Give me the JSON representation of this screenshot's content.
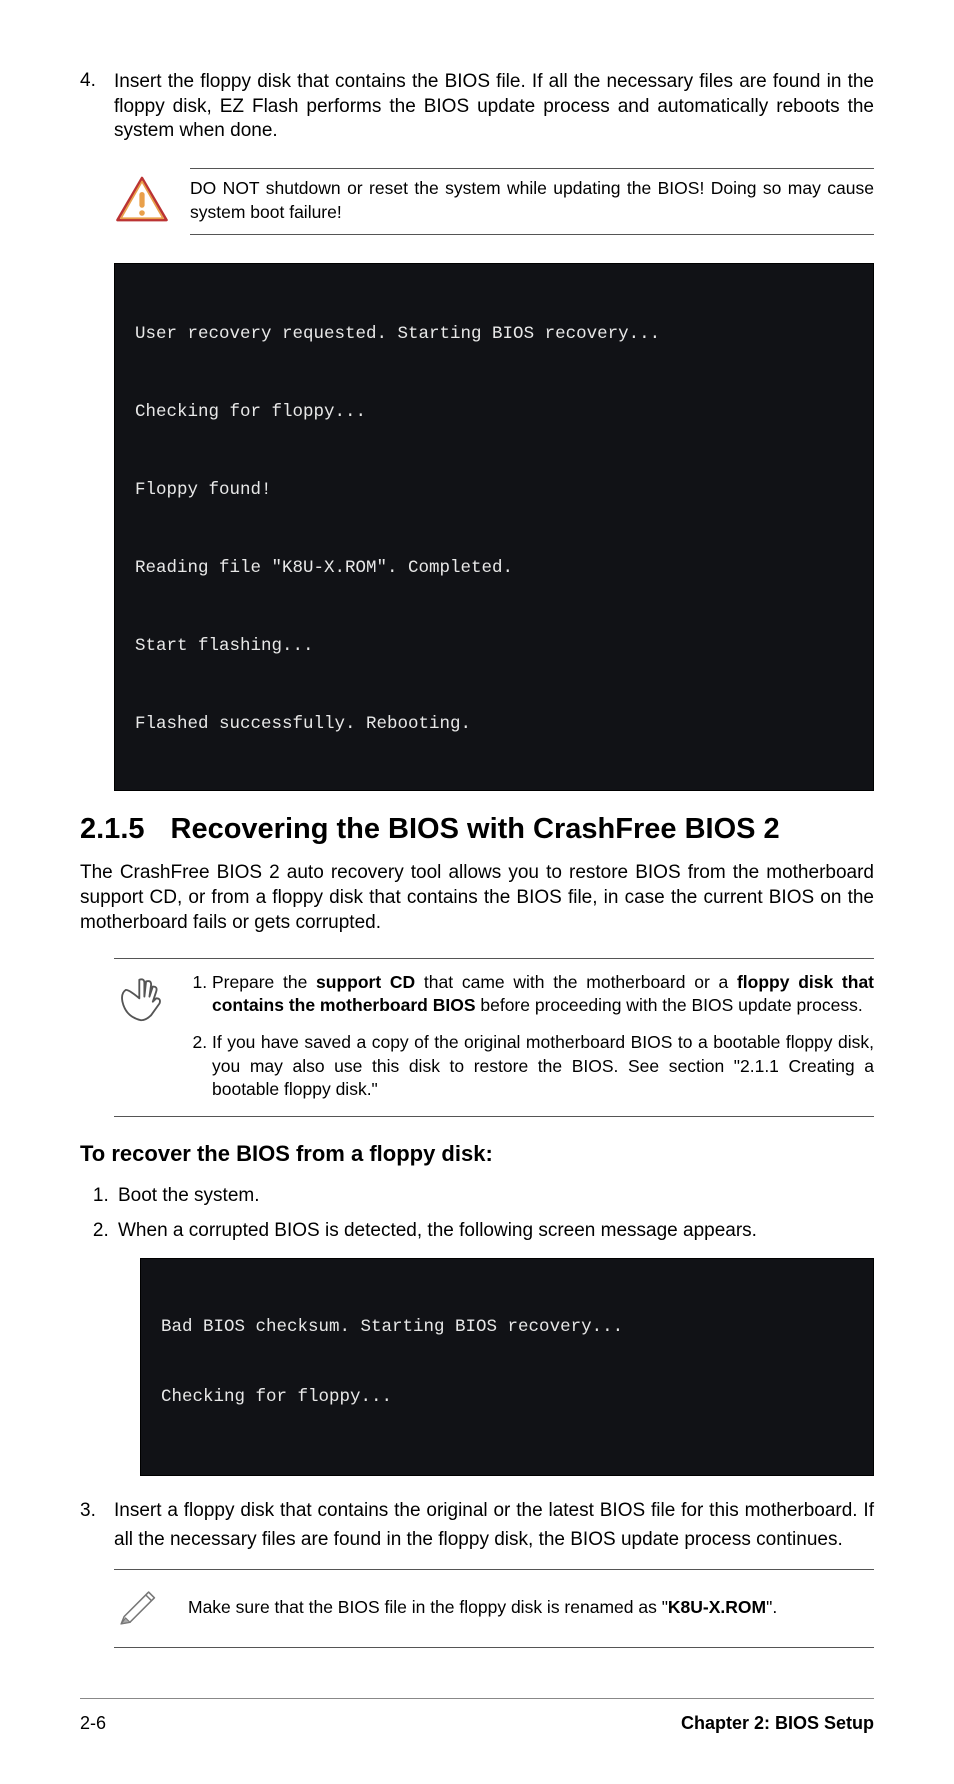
{
  "step4": {
    "num": "4.",
    "text": "Insert the floppy disk that contains the BIOS file. If all the necessary files are found in the floppy disk, EZ Flash performs the BIOS update process and automatically reboots the system when done."
  },
  "warning": {
    "text": "DO NOT shutdown or reset the system while updating the BIOS! Doing so may cause system boot failure!"
  },
  "terminal1": {
    "l1": "User recovery requested. Starting BIOS recovery...",
    "l2": "Checking for floppy...",
    "l3": "Floppy found!",
    "l4": "Reading file \"K8U-X.ROM\". Completed.",
    "l5": "Start flashing...",
    "l6": "Flashed successfully. Rebooting."
  },
  "section": {
    "num": "2.1.5",
    "title": "Recovering the BIOS with CrashFree BIOS 2",
    "intro": "The CrashFree BIOS 2 auto recovery tool allows you to restore BIOS from the motherboard support CD, or from a floppy disk that contains the BIOS file, in case the current BIOS on the motherboard fails or gets corrupted."
  },
  "notes": {
    "n1_a": "Prepare the ",
    "n1_b": "support CD",
    "n1_c": " that came with the motherboard or a ",
    "n1_d": "floppy disk that contains the motherboard BIOS",
    "n1_e": " before proceeding with the BIOS update process.",
    "n2": "If you have saved a copy of the original motherboard BIOS to a bootable floppy disk, you may also use this disk to restore the BIOS. See section \"2.1.1  Creating a bootable floppy disk.\""
  },
  "subheading": "To recover the BIOS from a floppy disk:",
  "steps": {
    "s1": "Boot the system.",
    "s2": "When a corrupted BIOS is detected, the following screen message appears."
  },
  "terminal2": {
    "l1": "Bad BIOS checksum. Starting BIOS recovery...",
    "l2": "Checking for floppy..."
  },
  "step3": {
    "num": "3.",
    "text": "Insert a floppy disk that contains the original or the latest BIOS file for this motherboard. If all the necessary files are found in the floppy disk, the BIOS update process continues."
  },
  "pencil": {
    "a": "Make sure that the BIOS file in the floppy disk is renamed as \"",
    "b": "K8U-X.ROM",
    "c": "\"."
  },
  "footer": {
    "left": "2-6",
    "right": "Chapter 2: BIOS Setup"
  }
}
